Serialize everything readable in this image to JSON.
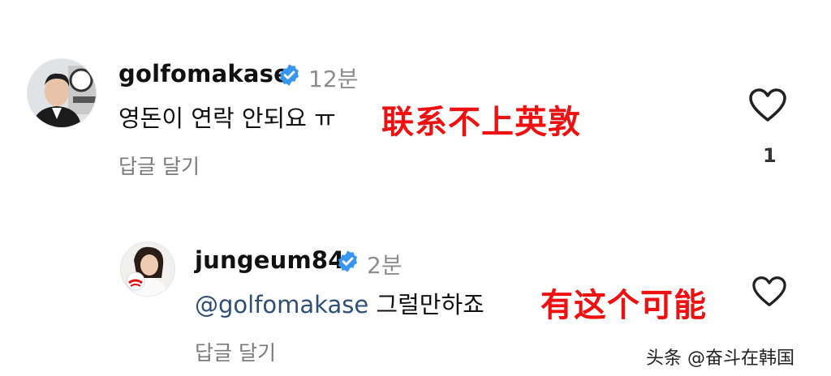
{
  "comments": [
    {
      "username": "golfomakase",
      "time": "12분",
      "text": "영돈이 연락 안되요 ㅠ",
      "overlay_caption": "联系不上英敦",
      "reply_label": "답글 달기",
      "like_count": "1",
      "avatar_icon": "person-photo-icon"
    },
    {
      "username": "jungeum84",
      "time": "2분",
      "mention": "@golfomakase",
      "text": " 그럴만하죠",
      "overlay_caption": "有这个可能",
      "reply_label": "답글 달기",
      "avatar_icon": "person-photo-icon"
    }
  ],
  "watermark": "头条 @奋斗在韩国",
  "colors": {
    "verified": "#3797f0",
    "overlay": "#ee1111",
    "mention": "#2f4f74",
    "muted": "#8e8e8e"
  }
}
